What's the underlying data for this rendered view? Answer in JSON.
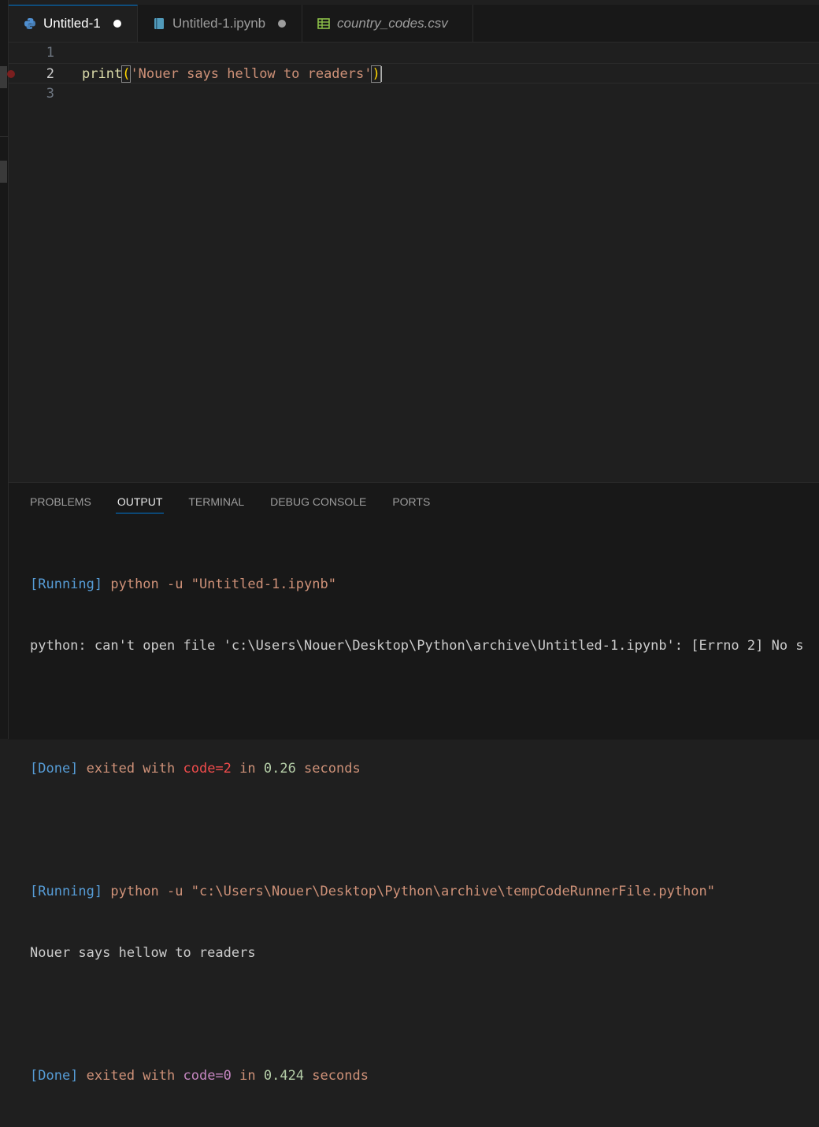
{
  "tabs": [
    {
      "label": "Untitled-1",
      "icon": "python-icon",
      "modified": true,
      "active": true
    },
    {
      "label": "Untitled-1.ipynb",
      "icon": "notebook-icon",
      "modified": true,
      "active": false
    },
    {
      "label": "country_codes.csv",
      "icon": "csv-icon",
      "modified": false,
      "active": false
    }
  ],
  "editor": {
    "line_numbers": [
      "1",
      "2",
      "3"
    ],
    "code": {
      "fn": "print",
      "open_paren": "(",
      "string": "'Nouer says hellow to readers'",
      "close_paren": ")"
    }
  },
  "panel": {
    "tabs": [
      "PROBLEMS",
      "OUTPUT",
      "TERMINAL",
      "DEBUG CONSOLE",
      "PORTS"
    ],
    "active_tab": "OUTPUT",
    "output": {
      "run1_tag": "[Running]",
      "run1_cmd": " python -u \"Untitled-1.ipynb\"",
      "error_line": "python: can't open file 'c:\\Users\\Nouer\\Desktop\\Python\\archive\\Untitled-1.ipynb': [Errno 2] No s",
      "done1_tag": "[Done]",
      "done1_a": " exited with ",
      "done1_code": "code=2",
      "done1_b": " in ",
      "done1_time": "0.26",
      "done1_c": " seconds",
      "run2_tag": "[Running]",
      "run2_cmd": " python -u \"c:\\Users\\Nouer\\Desktop\\Python\\archive\\tempCodeRunnerFile.python\"",
      "program_output": "Nouer says hellow to readers",
      "done2_tag": "[Done]",
      "done2_a": " exited with ",
      "done2_code": "code=0",
      "done2_b": " in ",
      "done2_time": "0.424",
      "done2_c": " seconds"
    }
  },
  "colors": {
    "accent": "#0078d4",
    "string": "#ce9178",
    "function": "#dcdcaa",
    "breakpoint": "#7a1f1f"
  }
}
